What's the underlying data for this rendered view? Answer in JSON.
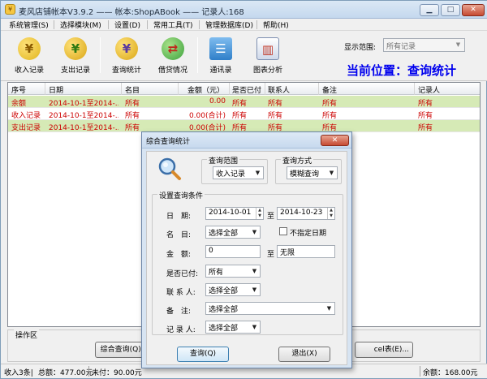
{
  "window": {
    "title": "麦风店铺帐本V3.9.2 —— 帐本:ShopABook —— 记录人:168",
    "minimize": "▁",
    "maximize": "□",
    "close": "✕"
  },
  "menu": [
    "系统管理(S)",
    "选择模块(M)",
    "设置(D)",
    "常用工具(T)",
    "管理数据库(D)",
    "帮助(H)"
  ],
  "toolbar": {
    "buttons": [
      {
        "label": "收入记录",
        "icon": "yen-income-icon",
        "glyph": "¥",
        "color": "#e0b41c"
      },
      {
        "label": "支出记录",
        "icon": "yen-expense-icon",
        "glyph": "¥",
        "color": "#63b82a"
      },
      {
        "label": "查询统计",
        "icon": "yen-query-icon",
        "glyph": "¥",
        "color": "#7a5cc0"
      },
      {
        "label": "借贷情况",
        "icon": "loan-icon",
        "glyph": "⇄",
        "color": "#3da23d"
      },
      {
        "label": "通讯录",
        "icon": "address-book-icon",
        "glyph": "☰",
        "color": "#2f7fc9"
      },
      {
        "label": "图表分析",
        "icon": "chart-icon",
        "glyph": "▥",
        "color": "#4a6fb0"
      }
    ],
    "range_label": "显示范围:",
    "range_value": "所有记录",
    "current_position": "当前位置：查询统计"
  },
  "grid": {
    "columns": [
      "序号",
      "日期",
      "名目",
      "金额（元）",
      "是否已付",
      "联系人",
      "备注",
      "记录人"
    ],
    "rows": [
      {
        "style": "green",
        "cells": [
          "余额",
          "2014-10-1至2014-...",
          "所有",
          "0.00",
          "所有",
          "所有",
          "所有",
          "所有"
        ]
      },
      {
        "style": "white",
        "cells": [
          "收入记录",
          "2014-10-1至2014-...",
          "所有",
          "0.00(合计)",
          "所有",
          "所有",
          "所有",
          "所有"
        ]
      },
      {
        "style": "green",
        "cells": [
          "支出记录",
          "2014-10-1至2014-...",
          "所有",
          "0.00(合计)",
          "所有",
          "所有",
          "所有",
          "所有"
        ]
      }
    ]
  },
  "ops": {
    "title": "操作区",
    "buttons": [
      "综合查询(Q)...",
      "cel表(E)..."
    ]
  },
  "status": {
    "left": "收入3条|",
    "total": "总额：477.00元",
    "unpaid": "未付：90.00元",
    "balance": "余额：168.00元"
  },
  "dialog": {
    "title": "综合查询统计",
    "close": "✕",
    "scope_group": "查询范围",
    "scope_value": "收入记录",
    "method_group": "查询方式",
    "method_value": "模糊查询",
    "conditions_group": "设置查询条件",
    "date_label": "日　期:",
    "date_from": "2014-10-01",
    "date_to": "2014-10-23",
    "to_label": "至",
    "category_label": "名　目:",
    "category_value": "选择全部",
    "no_date_label": "不指定日期",
    "amount_label": "金　额:",
    "amount_from": "0",
    "amount_to": "无限",
    "paid_label": "是否已付:",
    "paid_value": "所有",
    "contact_label": "联 系 人:",
    "contact_value": "选择全部",
    "remark_label": "备　注:",
    "remark_value": "选择全部",
    "recorder_label": "记 录 人:",
    "recorder_value": "选择全部",
    "query_button": "查询(Q)",
    "exit_button": "退出(X)"
  }
}
